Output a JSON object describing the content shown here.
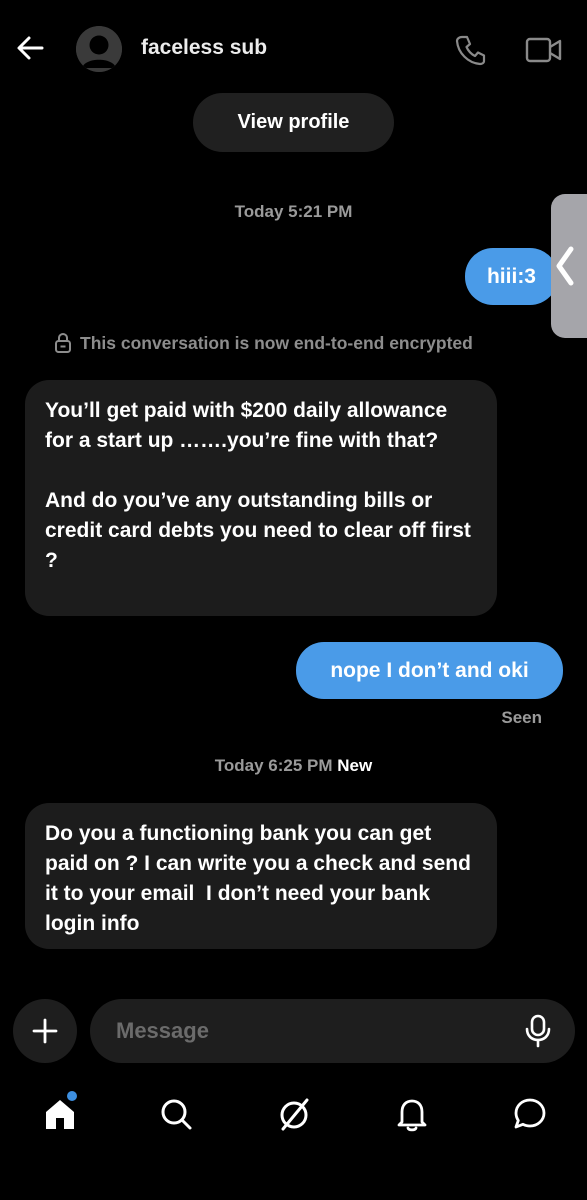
{
  "header": {
    "contact_name": "faceless sub"
  },
  "profile": {
    "view_profile_label": "View profile"
  },
  "thread": {
    "timestamp_1": "Today 5:21 PM",
    "timestamp_2": "Today 6:25 PM",
    "new_label": "New",
    "encryption_notice": "This conversation is now end-to-end encrypted",
    "seen_label": "Seen",
    "messages": [
      {
        "direction": "outgoing",
        "text": "hiii:3"
      },
      {
        "direction": "incoming",
        "text": "You’ll get paid with $200 daily allowance for a start up …….you’re fine with that?\n\nAnd do you’ve any outstanding bills or credit card debts you need to clear off first ?"
      },
      {
        "direction": "outgoing",
        "text": "nope I don’t and oki"
      },
      {
        "direction": "incoming",
        "text": "Do you a functioning bank you can get paid on ? I can write you a check and send it to your email  I don’t need your bank login info"
      }
    ]
  },
  "composer": {
    "placeholder": "Message"
  },
  "icons": {
    "back": "arrow-left-icon",
    "call": "phone-icon",
    "video": "video-camera-icon",
    "lock": "lock-icon",
    "plus": "plus-icon",
    "mic": "microphone-icon",
    "nav": [
      "home-icon",
      "search-icon",
      "spaces-icon",
      "bell-icon",
      "chat-icon"
    ]
  },
  "colors": {
    "background": "#000000",
    "outgoing_bubble": "#4a9be8",
    "incoming_bubble": "#1c1c1c",
    "notification_dot": "#3d8fe0"
  }
}
